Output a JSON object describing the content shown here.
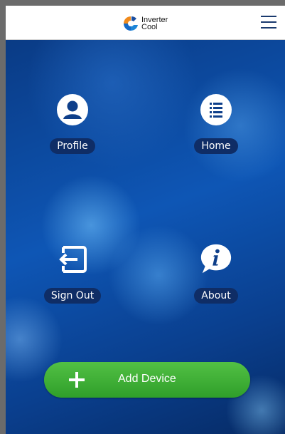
{
  "header": {
    "logo_line1": "Inverter",
    "logo_line2": "Cool",
    "menu_icon": "hamburger-menu-icon"
  },
  "tiles": [
    {
      "label": "Profile",
      "icon": "user-icon"
    },
    {
      "label": "Home",
      "icon": "list-icon"
    },
    {
      "label": "Sign Out",
      "icon": "sign-out-icon"
    },
    {
      "label": "About",
      "icon": "info-icon"
    }
  ],
  "add_device": {
    "label": "Add Device",
    "icon": "plus-icon"
  },
  "colors": {
    "accent_green": "#3fb338",
    "header_bg": "#ffffff",
    "label_bg": "#0f2d66"
  }
}
